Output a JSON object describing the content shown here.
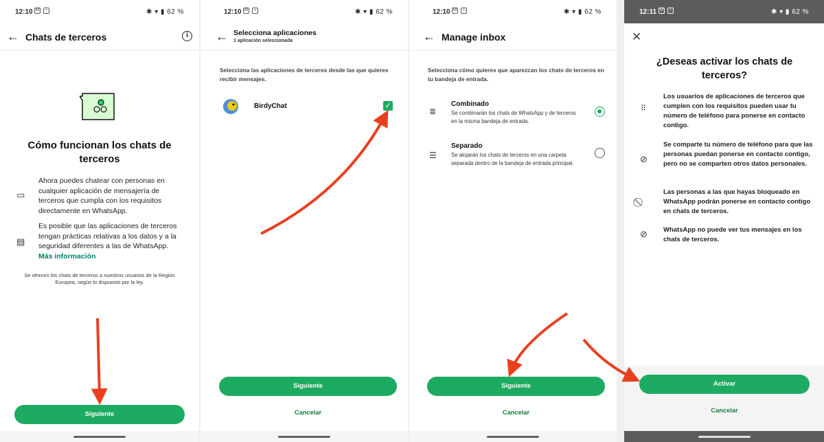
{
  "status_bars": [
    {
      "time": "12:10",
      "battery": "62 %"
    },
    {
      "time": "12:10",
      "battery": "62 %"
    },
    {
      "time": "12:10",
      "battery": "62 %"
    },
    {
      "time": "12:11",
      "battery": "62 %"
    }
  ],
  "screen1": {
    "title": "Chats de terceros",
    "heading": "Cómo funcionan los chats de terceros",
    "item1": "Ahora puedes chatear con personas en cualquier aplicación de mensajería de terceros que cumpla con los requisitos directamente en WhatsApp.",
    "item2": "Es posible que las aplicaciones de terceros tengan prácticas relativas a los datos y a la seguridad diferentes a las de WhatsApp.",
    "more_link": "Más información",
    "footnote": "Se ofrecen los chats de terceros a nuestros usuarios de la Región Europea, según lo dispuesto por la ley.",
    "next_button": "Siguiente"
  },
  "screen2": {
    "title": "Selecciona aplicaciones",
    "subtitle": "1 aplicación seleccionada",
    "intro": "Selecciona las aplicaciones de terceros desde las que quieres recibir mensajes.",
    "app_name": "BirdyChat",
    "next_button": "Siguiente",
    "cancel_button": "Cancelar"
  },
  "screen3": {
    "title": "Manage inbox",
    "intro": "Selecciona cómo quieres que aparezcan los chats de terceros en tu bandeja de entrada.",
    "options": [
      {
        "title": "Combinado",
        "desc": "Se combinarán los chats de WhatsApp y de terceros en la misma bandeja de entrada.",
        "selected": true
      },
      {
        "title": "Separado",
        "desc": "Se alojarán los chats de terceros en una carpeta separada dentro de la bandeja de entrada principal.",
        "selected": false
      }
    ],
    "next_button": "Siguiente",
    "cancel_button": "Cancelar"
  },
  "screen4": {
    "heading": "¿Deseas activar los chats de terceros?",
    "items": [
      "Los usuarios de aplicaciones de terceros que cumplen con los requisitos pueden usar tu número de teléfono para ponerse en contacto contigo.",
      "Se comparte tu número de teléfono para que las personas puedan ponerse en contacto contigo, pero no se comparten otros datos personales.",
      "Las personas a las que hayas bloqueado en WhatsApp podrán ponerse en contacto contigo en chats de terceros.",
      "WhatsApp no puede ver tus mensajes en los chats de terceros."
    ],
    "activate_button": "Activar",
    "cancel_button": "Cancelar"
  },
  "colors": {
    "accent": "#1daa61",
    "arrow": "#e8401f",
    "link": "#008069"
  }
}
